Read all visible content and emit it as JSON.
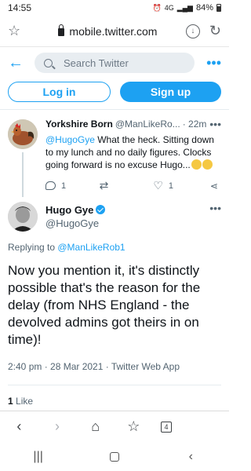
{
  "status_bar": {
    "time": "14:55",
    "network": "4G",
    "battery": "84%"
  },
  "browser": {
    "url": "mobile.twitter.com",
    "tab_count": "4"
  },
  "twitter_header": {
    "search_placeholder": "Search Twitter"
  },
  "auth": {
    "login_label": "Log in",
    "signup_label": "Sign up"
  },
  "parent_tweet": {
    "name": "Yorkshire Born",
    "handle": "@ManLikeRo...",
    "time": "· 22m",
    "mention": "@HugoGye",
    "text": " What the heck. Sitting down to my lunch and no daily figures. Clocks going forward is no excuse Hugo...",
    "reply_count": "1",
    "like_count": "1"
  },
  "focus_tweet": {
    "name": "Hugo Gye",
    "handle": "@HugoGye",
    "replying_prefix": "Replying to ",
    "replying_to": "@ManLikeRob1",
    "text": "Now you mention it, it's distinctly possible that's the reason for the delay (from NHS England - the devolved admins got theirs in on time)!",
    "timestamp": "2:40 pm · 28 Mar 2021 · Twitter Web App",
    "likes_count": "1",
    "likes_label": " Like"
  },
  "colors": {
    "accent": "#1da1f2",
    "muted": "#536471"
  }
}
